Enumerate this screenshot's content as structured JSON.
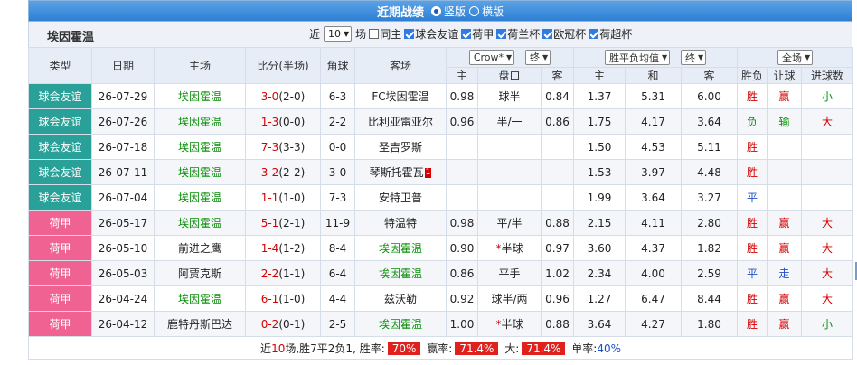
{
  "header": {
    "title": "近期战绩",
    "view_vertical": "竖版",
    "view_horizontal": "横版"
  },
  "filter": {
    "team_name": "埃因霍温",
    "recent_label": "近",
    "count_value": "10",
    "count_unit": "场",
    "same_home_label": "同主",
    "competitions": [
      {
        "label": "球会友谊",
        "checked": true
      },
      {
        "label": "荷甲",
        "checked": true
      },
      {
        "label": "荷兰杯",
        "checked": true
      },
      {
        "label": "欧冠杯",
        "checked": true
      },
      {
        "label": "荷超杯",
        "checked": true
      }
    ]
  },
  "table": {
    "headers": {
      "type": "类型",
      "date": "日期",
      "home": "主场",
      "score": "比分(半场)",
      "corner": "角球",
      "away": "客场",
      "company_select": "Crow*",
      "phase_select": "终",
      "odds_type_select": "胜平负均值",
      "phase_select2": "终",
      "scope_select": "全场",
      "ah_home": "主",
      "ah_line": "盘口",
      "ah_away": "客",
      "eu_home": "主",
      "eu_draw": "和",
      "eu_away": "客",
      "result": "胜负",
      "handicap_result": "让球",
      "goals": "进球数"
    },
    "rows": [
      {
        "type": "球会友谊",
        "type_class": "friendly",
        "date": "26-07-29",
        "home": "埃因霍温",
        "home_color": "green",
        "score": "3-0",
        "half": "(2-0)",
        "corner": "6-3",
        "away": "FC埃因霍温",
        "away_color": "black",
        "away_badge": "",
        "ah_home": "0.98",
        "ah_line": "球半",
        "ah_star": "",
        "ah_away": "0.84",
        "eu_home": "1.37",
        "eu_draw": "5.31",
        "eu_away": "6.00",
        "result": "胜",
        "result_color": "red",
        "hc": "赢",
        "hc_color": "red",
        "goals": "小",
        "goals_color": "green"
      },
      {
        "type": "球会友谊",
        "type_class": "friendly",
        "date": "26-07-26",
        "home": "埃因霍温",
        "home_color": "green",
        "score": "1-3",
        "half": "(0-0)",
        "corner": "2-2",
        "away": "比利亚雷亚尔",
        "away_color": "black",
        "away_badge": "",
        "ah_home": "0.96",
        "ah_line": "半/一",
        "ah_star": "",
        "ah_away": "0.86",
        "eu_home": "1.75",
        "eu_draw": "4.17",
        "eu_away": "3.64",
        "result": "负",
        "result_color": "green",
        "hc": "输",
        "hc_color": "green",
        "goals": "大",
        "goals_color": "red"
      },
      {
        "type": "球会友谊",
        "type_class": "friendly",
        "date": "26-07-18",
        "home": "埃因霍温",
        "home_color": "green",
        "score": "7-3",
        "half": "(3-3)",
        "corner": "0-0",
        "away": "圣吉罗斯",
        "away_color": "black",
        "away_badge": "",
        "ah_home": "",
        "ah_line": "",
        "ah_star": "",
        "ah_away": "",
        "eu_home": "1.50",
        "eu_draw": "4.53",
        "eu_away": "5.11",
        "result": "胜",
        "result_color": "red",
        "hc": "",
        "hc_color": "red",
        "goals": "",
        "goals_color": "red"
      },
      {
        "type": "球会友谊",
        "type_class": "friendly",
        "date": "26-07-11",
        "home": "埃因霍温",
        "home_color": "green",
        "score": "3-2",
        "half": "(2-2)",
        "corner": "3-0",
        "away": "琴斯托霍瓦",
        "away_color": "black",
        "away_badge": "1",
        "ah_home": "",
        "ah_line": "",
        "ah_star": "",
        "ah_away": "",
        "eu_home": "1.53",
        "eu_draw": "3.97",
        "eu_away": "4.48",
        "result": "胜",
        "result_color": "red",
        "hc": "",
        "hc_color": "red",
        "goals": "",
        "goals_color": "red"
      },
      {
        "type": "球会友谊",
        "type_class": "friendly",
        "date": "26-07-04",
        "home": "埃因霍温",
        "home_color": "green",
        "score": "1-1",
        "half": "(1-0)",
        "corner": "7-3",
        "away": "安特卫普",
        "away_color": "black",
        "away_badge": "",
        "ah_home": "",
        "ah_line": "",
        "ah_star": "",
        "ah_away": "",
        "eu_home": "1.99",
        "eu_draw": "3.64",
        "eu_away": "3.27",
        "result": "平",
        "result_color": "blue",
        "hc": "",
        "hc_color": "red",
        "goals": "",
        "goals_color": "red"
      },
      {
        "type": "荷甲",
        "type_class": "league",
        "date": "26-05-17",
        "home": "埃因霍温",
        "home_color": "green",
        "score": "5-1",
        "half": "(2-1)",
        "corner": "11-9",
        "away": "特温特",
        "away_color": "black",
        "away_badge": "",
        "ah_home": "0.98",
        "ah_line": "平/半",
        "ah_star": "",
        "ah_away": "0.88",
        "eu_home": "2.15",
        "eu_draw": "4.11",
        "eu_away": "2.80",
        "result": "胜",
        "result_color": "red",
        "hc": "赢",
        "hc_color": "red",
        "goals": "大",
        "goals_color": "red"
      },
      {
        "type": "荷甲",
        "type_class": "league",
        "date": "26-05-10",
        "home": "前进之鹰",
        "home_color": "black",
        "score": "1-4",
        "half": "(1-2)",
        "corner": "8-4",
        "away": "埃因霍温",
        "away_color": "green",
        "away_badge": "",
        "ah_home": "0.90",
        "ah_line": "半球",
        "ah_star": "*",
        "ah_away": "0.97",
        "eu_home": "3.60",
        "eu_draw": "4.37",
        "eu_away": "1.82",
        "result": "胜",
        "result_color": "red",
        "hc": "赢",
        "hc_color": "red",
        "goals": "大",
        "goals_color": "red"
      },
      {
        "type": "荷甲",
        "type_class": "league",
        "date": "26-05-03",
        "home": "阿贾克斯",
        "home_color": "black",
        "score": "2-2",
        "half": "(1-1)",
        "corner": "6-4",
        "away": "埃因霍温",
        "away_color": "green",
        "away_badge": "",
        "ah_home": "0.86",
        "ah_line": "平手",
        "ah_star": "",
        "ah_away": "1.02",
        "eu_home": "2.34",
        "eu_draw": "4.00",
        "eu_away": "2.59",
        "result": "平",
        "result_color": "blue",
        "hc": "走",
        "hc_color": "blue",
        "goals": "大",
        "goals_color": "red"
      },
      {
        "type": "荷甲",
        "type_class": "league",
        "date": "26-04-24",
        "home": "埃因霍温",
        "home_color": "green",
        "score": "6-1",
        "half": "(1-0)",
        "corner": "4-4",
        "away": "兹沃勒",
        "away_color": "black",
        "away_badge": "",
        "ah_home": "0.92",
        "ah_line": "球半/两",
        "ah_star": "",
        "ah_away": "0.96",
        "eu_home": "1.27",
        "eu_draw": "6.47",
        "eu_away": "8.44",
        "result": "胜",
        "result_color": "red",
        "hc": "赢",
        "hc_color": "red",
        "goals": "大",
        "goals_color": "red"
      },
      {
        "type": "荷甲",
        "type_class": "league",
        "date": "26-04-12",
        "home": "鹿特丹斯巴达",
        "home_color": "black",
        "score": "0-2",
        "half": "(0-1)",
        "corner": "2-5",
        "away": "埃因霍温",
        "away_color": "green",
        "away_badge": "",
        "ah_home": "1.00",
        "ah_line": "半球",
        "ah_star": "*",
        "ah_away": "0.88",
        "eu_home": "3.64",
        "eu_draw": "4.27",
        "eu_away": "1.80",
        "result": "胜",
        "result_color": "red",
        "hc": "赢",
        "hc_color": "red",
        "goals": "小",
        "goals_color": "green"
      }
    ],
    "summary": {
      "prefix": "近",
      "count": "10",
      "record": "场,胜7平2负1,",
      "win_label": "胜率:",
      "win_rate": "70%",
      "hc_label": "赢率:",
      "hc_rate": "71.4%",
      "big_label": "大:",
      "big_rate": "71.4%",
      "odd_label": "单率:",
      "odd_rate": "40%"
    }
  },
  "colors": {
    "header_bar": "#2e7fd3",
    "friendly": "#2aa198",
    "league": "#f06292",
    "win_red": "#d40000",
    "home_green": "#0a8f0a"
  }
}
